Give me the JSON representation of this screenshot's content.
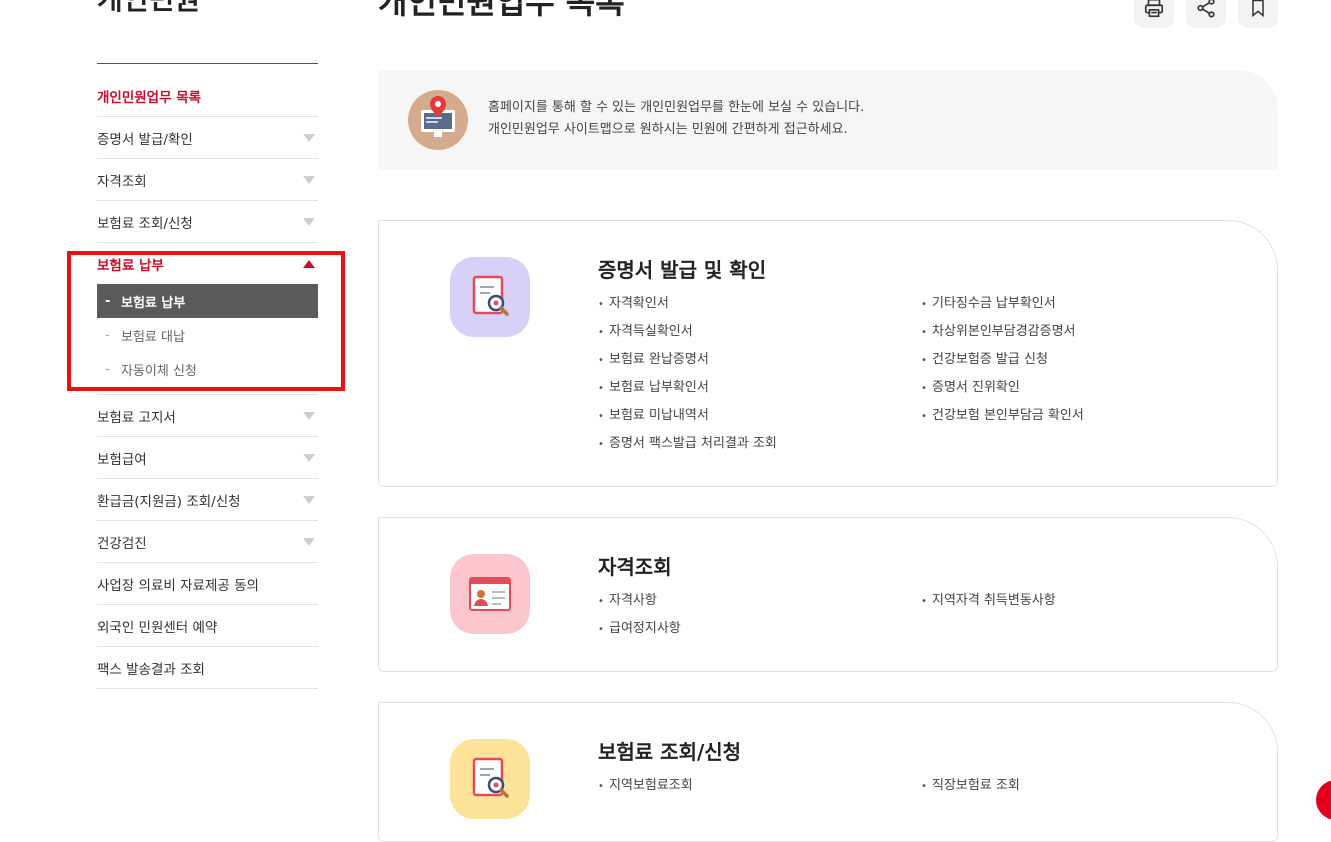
{
  "sidebar": {
    "title": "개인민원",
    "items": [
      {
        "label": "개인민원업무 목록"
      },
      {
        "label": "증명서 발급/확인"
      },
      {
        "label": "자격조회"
      },
      {
        "label": "보험료 조회/신청"
      },
      {
        "label": "보험료 납부"
      },
      {
        "label": "보험료 고지서"
      },
      {
        "label": "보험급여"
      },
      {
        "label": "환급금(지원금) 조회/신청"
      },
      {
        "label": "건강검진"
      },
      {
        "label": "사업장 의료비 자료제공 동의"
      },
      {
        "label": "외국인 민원센터 예약"
      },
      {
        "label": "팩스 발송결과 조회"
      }
    ],
    "submenu": {
      "dash": "-",
      "items": [
        {
          "label": "보험료 납부"
        },
        {
          "label": "보험료 대납"
        },
        {
          "label": "자동이체 신청"
        }
      ]
    }
  },
  "main": {
    "title": "개인민원업무 목록",
    "toolbar": {
      "print_icon": "printer-icon",
      "share_icon": "share-icon",
      "bookmark_icon": "bookmark-icon"
    },
    "intro": {
      "line1": "홈페이지를 통해 할 수 있는 개인민원업무를 한눈에 보실 수 있습니다.",
      "line2": "개인민원업무 사이트맵으로 원하시는 민원에 간편하게 접근하세요."
    },
    "cards": [
      {
        "title": "증명서 발급 및 확인",
        "icon": "document-magnifier-icon",
        "col1": [
          "자격확인서",
          "자격득실확인서",
          "보험료 완납증명서",
          "보험료 납부확인서",
          "보험료 미납내역서",
          "증명서 팩스발급 처리결과 조회"
        ],
        "col2": [
          "기타징수금 납부확인서",
          "차상위본인부담경감증명서",
          "건강보험증 발급 신청",
          "증명서 진위확인",
          "건강보험 본인부담금 확인서"
        ]
      },
      {
        "title": "자격조회",
        "icon": "id-card-icon",
        "col1": [
          "자격사항",
          "급여정지사항"
        ],
        "col2": [
          "지역자격 취득변동사항"
        ]
      },
      {
        "title": "보험료 조회/신청",
        "icon": "document-magnifier-icon",
        "col1": [
          "지역보험료조회"
        ],
        "col2": [
          "직장보험료 조회"
        ]
      }
    ]
  },
  "colors": {
    "accent_red": "#c8102e",
    "highlight_box": "#ee1111",
    "submenu_active": "#5a5a5a",
    "card1_icon_bg": "#d9d0f7",
    "card2_icon_bg": "#fcc7cc",
    "card3_icon_bg": "#fde39a"
  }
}
